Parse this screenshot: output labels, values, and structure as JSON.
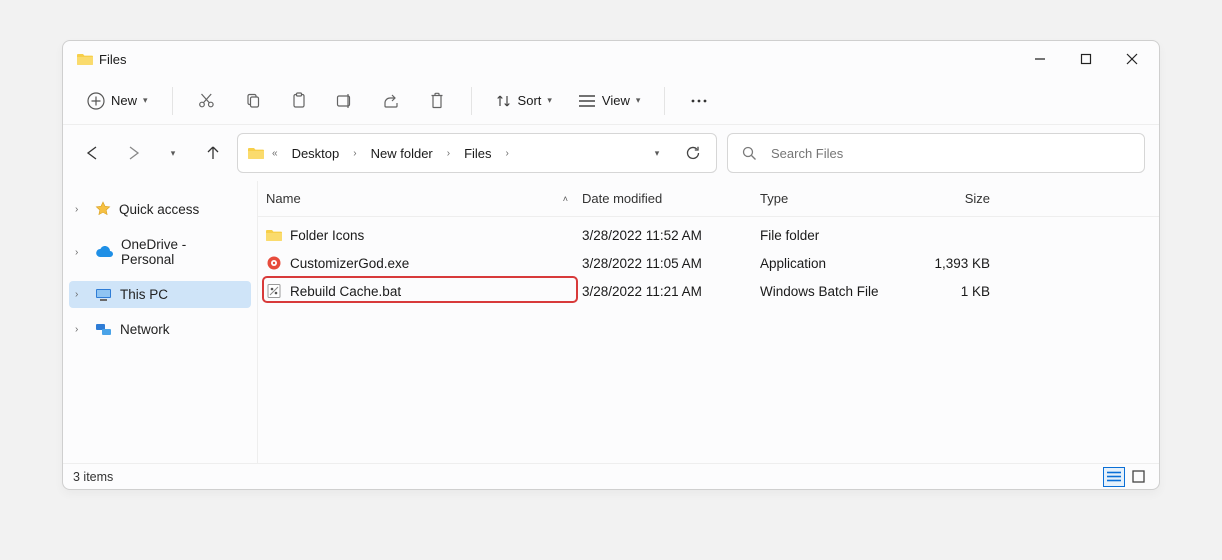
{
  "window": {
    "title": "Files"
  },
  "toolbar": {
    "new_label": "New",
    "sort_label": "Sort",
    "view_label": "View"
  },
  "breadcrumbs": [
    "Desktop",
    "New folder",
    "Files"
  ],
  "search": {
    "placeholder": "Search Files"
  },
  "sidebar": {
    "items": [
      {
        "label": "Quick access",
        "selected": false
      },
      {
        "label": "OneDrive - Personal",
        "selected": false
      },
      {
        "label": "This PC",
        "selected": true
      },
      {
        "label": "Network",
        "selected": false
      }
    ]
  },
  "columns": {
    "name": "Name",
    "date": "Date modified",
    "type": "Type",
    "size": "Size"
  },
  "files": [
    {
      "name": "Folder Icons",
      "date": "3/28/2022 11:52 AM",
      "type": "File folder",
      "size": ""
    },
    {
      "name": "CustomizerGod.exe",
      "date": "3/28/2022 11:05 AM",
      "type": "Application",
      "size": "1,393 KB"
    },
    {
      "name": "Rebuild Cache.bat",
      "date": "3/28/2022 11:21 AM",
      "type": "Windows Batch File",
      "size": "1 KB",
      "highlighted": true
    }
  ],
  "status": {
    "items_text": "3 items"
  }
}
